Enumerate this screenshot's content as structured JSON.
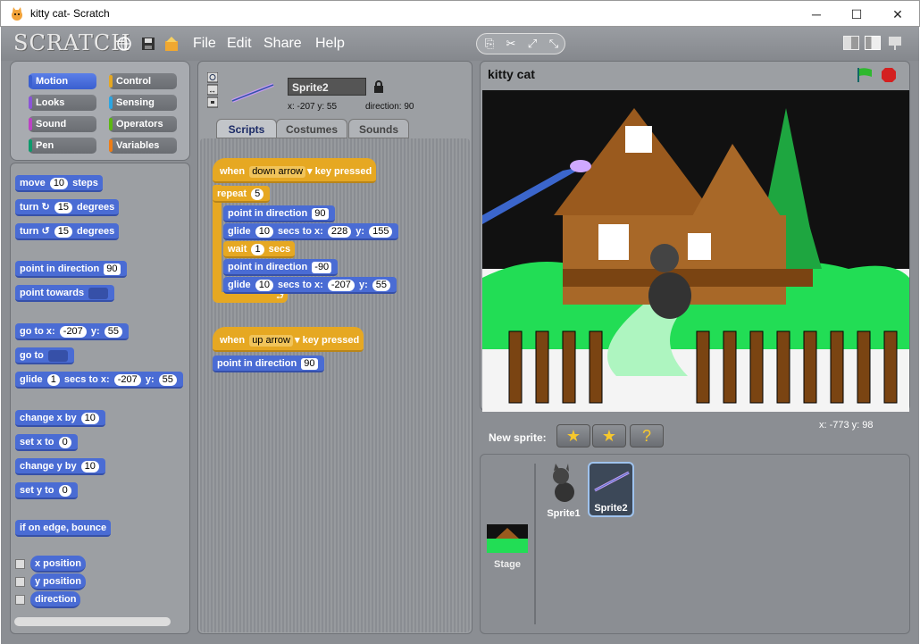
{
  "window": {
    "title": "kitty cat- Scratch",
    "minimize": "─",
    "maximize": "☐",
    "close": "✕"
  },
  "menubar": {
    "logo": "SCRATCH",
    "menus": [
      "File",
      "Edit",
      "Share",
      "Help"
    ]
  },
  "categories": [
    {
      "label": "Motion",
      "color": "#4a6cd4"
    },
    {
      "label": "Control",
      "color": "#e6a822"
    },
    {
      "label": "Looks",
      "color": "#8a55d7"
    },
    {
      "label": "Sensing",
      "color": "#2ca5e2"
    },
    {
      "label": "Sound",
      "color": "#bb42c3"
    },
    {
      "label": "Operators",
      "color": "#5cb712"
    },
    {
      "label": "Pen",
      "color": "#0e9a6c"
    },
    {
      "label": "Variables",
      "color": "#ee7d16"
    }
  ],
  "palette": {
    "move": {
      "a": "move",
      "v": "10",
      "b": "steps"
    },
    "turn_cw": {
      "a": "turn",
      "v": "15",
      "b": "degrees"
    },
    "turn_ccw": {
      "a": "turn",
      "v": "15",
      "b": "degrees"
    },
    "point_dir": {
      "a": "point in direction",
      "v": "90"
    },
    "point_towards": {
      "a": "point towards"
    },
    "goto_xy": {
      "a": "go to x:",
      "x": "-207",
      "b": "y:",
      "y": "55"
    },
    "goto": {
      "a": "go to"
    },
    "glide": {
      "a": "glide",
      "v": "1",
      "b": "secs to x:",
      "x": "-207",
      "c": "y:",
      "y": "55"
    },
    "change_x": {
      "a": "change x by",
      "v": "10"
    },
    "set_x": {
      "a": "set x to",
      "v": "0"
    },
    "change_y": {
      "a": "change y by",
      "v": "10"
    },
    "set_y": {
      "a": "set y to",
      "v": "0"
    },
    "bounce": {
      "a": "if on edge, bounce"
    },
    "x_position": "x position",
    "y_position": "y position",
    "direction": "direction"
  },
  "sprite": {
    "name": "Sprite2",
    "coords": "x: -207  y: 55",
    "direction": "direction:  90"
  },
  "tabs": [
    "Scripts",
    "Costumes",
    "Sounds"
  ],
  "scripts": {
    "s1": {
      "when": "when",
      "key": "down arrow",
      "pressed": "key pressed",
      "repeat": "repeat",
      "repeat_n": "5",
      "p1": "point in direction",
      "p1v": "90",
      "g1": "glide",
      "g1s": "10",
      "g1b": "secs to x:",
      "g1x": "228",
      "g1c": "y:",
      "g1y": "155",
      "wait": "wait",
      "waitv": "1",
      "waitb": "secs",
      "p2": "point in direction",
      "p2v": "-90",
      "g2": "glide",
      "g2s": "10",
      "g2b": "secs to x:",
      "g2x": "-207",
      "g2c": "y:",
      "g2y": "55"
    },
    "s2": {
      "when": "when",
      "key": "up arrow",
      "pressed": "key pressed",
      "p": "point in direction",
      "pv": "90"
    }
  },
  "stage": {
    "title": "kitty cat",
    "mouse": "x: -773   y: 98"
  },
  "sprites_panel": {
    "new_sprite": "New sprite:",
    "stage_label": "Stage",
    "sprites": [
      "Sprite1",
      "Sprite2"
    ]
  },
  "colors": {
    "motion": "#4a6cd4",
    "control": "#e6a822",
    "green_flag": "#2eb82e",
    "stop": "#d42020"
  }
}
